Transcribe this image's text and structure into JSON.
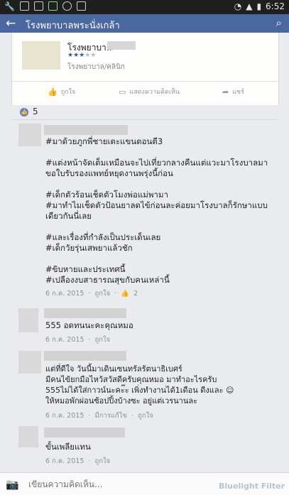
{
  "status_bar": {
    "time": "6:52"
  },
  "header": {
    "back_glyph": "←",
    "title": "โรงพยาบาลพระนั่งเกล้า",
    "search_glyph": "⌕"
  },
  "shared_card": {
    "place_name": "โรงพยาบาล",
    "stars_on": "★★★",
    "stars_off": "★★",
    "place_type": "โรงพยาบาล/คลินิก",
    "actions": {
      "like": "ถูกใจ",
      "comment": "แสดงความคิดเห็น",
      "share": "แชร์"
    }
  },
  "likes": {
    "count": "5"
  },
  "comments": [
    {
      "text": "#มาด้วยภูกพี่ชายเตะแขนตอนตี3\n\n#แต่งหน้าจัดเต็มเหมือนจะไปเที่ยวกลางคืนแต่แวะมาโรงบาลมาขอใบรับรองแพทย์หยุดงานพรุ่งนี้ก่อน\n\n#เด็กตัวร้อนเช็ดตัวโมงพ่อแม่พามา\n#มาทำไมเช็ดตัวป้อนยาลดไข้ก่อนละค่อยมาโรงบาลก็รักษาแบบเดียวกันนี่เลย\n\n#และเรื่องที่กำลังเป็นประเด็นเลย\n#เด็กวัยรุ่นเสพยาแล้วชัก\n\n#ขิบหายและประเทศนี้\n#เปลืองงบสาธารณสุขกับคนเหล่านี้",
      "date": "6 ก.ค. 2015",
      "like": "ถูกใจ",
      "likes": "2"
    },
    {
      "text": "555 อดทนนะคะคุณหมอ",
      "date": "6 ก.ค. 2015",
      "like": "ถูกใจ"
    },
    {
      "text": "แต่ที่ดีใจ วันนี้มาเดินเซนทรัลรัตนาธิเบศร์\nมีคนไข้ยกมือไหว้สวัสดีครับคุณหมอ มาทำอะไรครับ\n555ไม่ได้ใส่กาวน์นะคะ๊ะ เพิ่งทำงานได้1เดือน ดีงและ ☺\nให้หมอพักผ่อนซ้อปปิ้งบ้างซะ อยู่แต่เวรนานละ",
      "date": "6 ก.ค. 2015",
      "edited": "มีการแก้ไข",
      "like": "ถูกใจ"
    },
    {
      "text": "ขั้นเพลียแทน",
      "date": "6 ก.ค. 2015",
      "like": "ถูกใจ"
    }
  ],
  "composer": {
    "placeholder": "เขียนความคิดเห็น...",
    "watermark": "Bluelight Filter"
  }
}
